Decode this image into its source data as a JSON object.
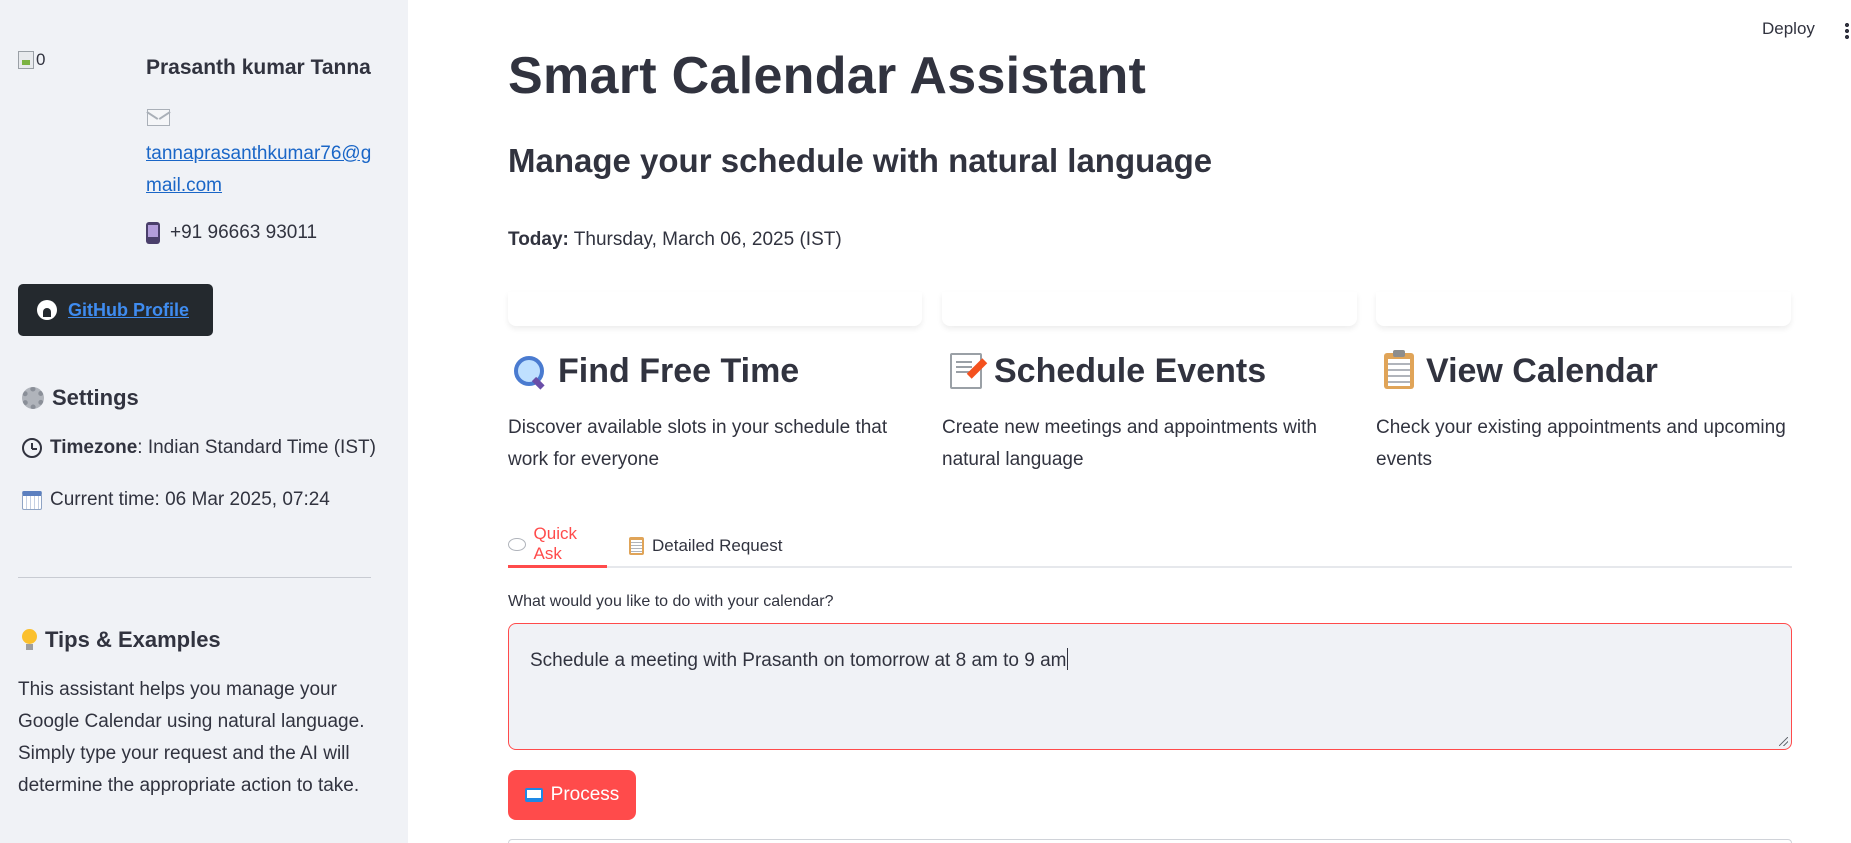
{
  "profile": {
    "avatar_alt": "0",
    "name": "Prasanth kumar Tanna",
    "email": "tannaprasanthkumar76@gmail.com",
    "phone": "+91 96663 93011",
    "github_label": "GitHub Profile"
  },
  "settings": {
    "title": "Settings",
    "timezone_label": "Timezone",
    "timezone_value": ": Indian Standard Time (IST)",
    "current_time": "Current time: 06 Mar 2025, 07:24"
  },
  "tips": {
    "title": "Tips & Examples",
    "text": "This assistant helps you manage your Google Calendar using natural language. Simply type your request and the AI will determine the appropriate action to take."
  },
  "header": {
    "deploy_label": "Deploy"
  },
  "main": {
    "title": "Smart Calendar Assistant",
    "subtitle": "Manage your schedule with natural language",
    "today_label": "Today:",
    "today_value": " Thursday, March 06, 2025 (IST)",
    "features": [
      {
        "title": "Find Free Time",
        "description": "Discover available slots in your schedule that work for everyone",
        "icon": "magnifying-glass-icon"
      },
      {
        "title": "Schedule Events",
        "description": "Create new meetings and appointments with natural language",
        "icon": "memo-icon"
      },
      {
        "title": "View Calendar",
        "description": "Check your existing appointments and upcoming events",
        "icon": "clipboard-icon"
      }
    ],
    "tabs": [
      {
        "label": "Quick Ask",
        "icon": "speech-bubble-icon",
        "active": true
      },
      {
        "label": "Detailed Request",
        "icon": "clipboard-icon",
        "active": false
      }
    ],
    "input_label": "What would you like to do with your calendar?",
    "input_value": "Schedule a meeting with Prasanth on tomorrow at 8 am to 9 am",
    "process_label": "Process"
  },
  "colors": {
    "accent": "#ff4b4b",
    "sidebar_bg": "#f0f2f6",
    "text": "#31333f",
    "link": "#1a66c7",
    "github_bg": "#24292e"
  }
}
